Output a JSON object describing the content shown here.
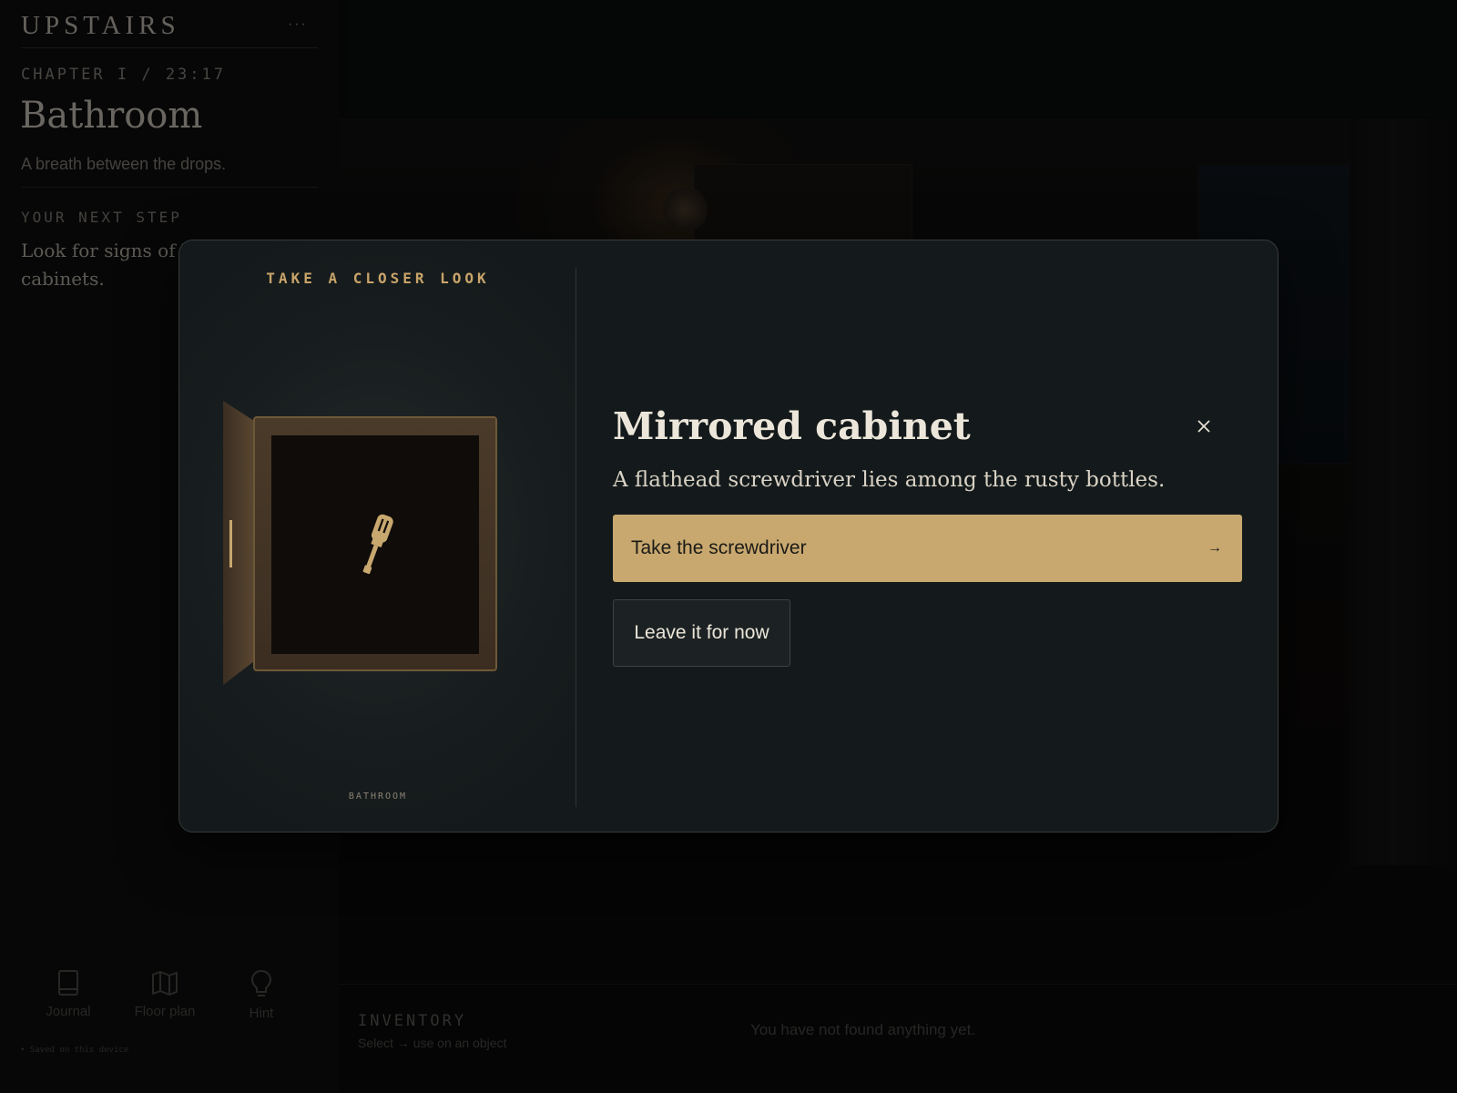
{
  "sidebar": {
    "app_title": "UPSTAIRS",
    "menu": "···",
    "chapter": "CHAPTER I / 23:17",
    "room_title": "Bathroom",
    "room_subtitle": "A breath between the drops.",
    "next_step_label": "YOUR NEXT STEP",
    "next_step_text": "Look for signs of life in the cabinets.",
    "nav": [
      {
        "label": "Journal",
        "icon": "book-icon"
      },
      {
        "label": "Floor plan",
        "icon": "map-icon"
      },
      {
        "label": "Hint",
        "icon": "lightbulb-icon"
      }
    ],
    "saved_note": "• Saved on this device"
  },
  "inventory": {
    "label": "INVENTORY",
    "hint": "Select → use on an object",
    "empty_text": "You have not found anything yet."
  },
  "modal": {
    "eyebrow": "TAKE A CLOSER LOOK",
    "location_tag": "BATHROOM",
    "illustration": "open-cabinet-with-screwdriver-icon",
    "title": "Mirrored cabinet",
    "description": "A flathead screwdriver lies among the rusty bottles.",
    "close_icon": "close-icon",
    "primary_action": {
      "label": "Take the screwdriver",
      "arrow": "→"
    },
    "secondary_action": {
      "label": "Leave it for now"
    }
  },
  "colors": {
    "accent_gold": "#c8a86f",
    "modal_bg": "#141a1b",
    "title_text": "#ece6da"
  }
}
